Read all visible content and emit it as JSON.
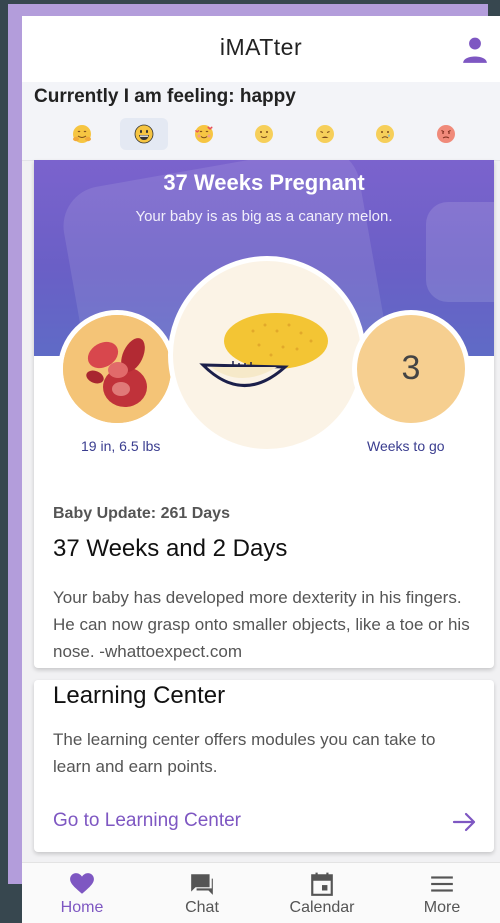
{
  "header": {
    "title": "iMATter",
    "profile_icon": "person-icon"
  },
  "mood": {
    "label": "Currently I am feeling: happy",
    "selected": "happy",
    "options": [
      {
        "name": "hugging-face-icon",
        "color": "#f6c542"
      },
      {
        "name": "grinning-face-icon",
        "color": "#f6c542"
      },
      {
        "name": "smiling-face-with-hearts-icon",
        "color": "#f6c542"
      },
      {
        "name": "slightly-smiling-face-icon",
        "color": "#f6c542"
      },
      {
        "name": "weary-face-icon",
        "color": "#f6c542"
      },
      {
        "name": "crying-face-icon",
        "color": "#f6c542"
      },
      {
        "name": "angry-face-icon",
        "color": "#f08a7a"
      }
    ]
  },
  "pregnancy": {
    "title": "37 Weeks Pregnant",
    "subtitle": "Your baby is as big as a canary melon.",
    "size": "19 in, 6.5 lbs",
    "weeks_remaining": "3",
    "weeks_remaining_label": "Weeks to go"
  },
  "update": {
    "label": "Baby Update: 261 Days",
    "heading": "37 Weeks and 2 Days",
    "body": "Your baby has developed more dexterity in his fingers. He can now grasp onto smaller objects, like a toe or his nose. -whattoexpect.com"
  },
  "learning": {
    "title": "Learning Center",
    "body": "The learning center offers modules you can take to learn and earn points.",
    "link": "Go to Learning Center"
  },
  "nav": {
    "items": [
      {
        "label": "Home",
        "icon": "heart-icon"
      },
      {
        "label": "Chat",
        "icon": "chat-icon"
      },
      {
        "label": "Calendar",
        "icon": "calendar-icon"
      },
      {
        "label": "More",
        "icon": "menu-icon"
      }
    ],
    "active": "Home"
  },
  "colors": {
    "accent": "#7e57c2",
    "banner": "#6a5fc6",
    "background": "#37474f"
  }
}
